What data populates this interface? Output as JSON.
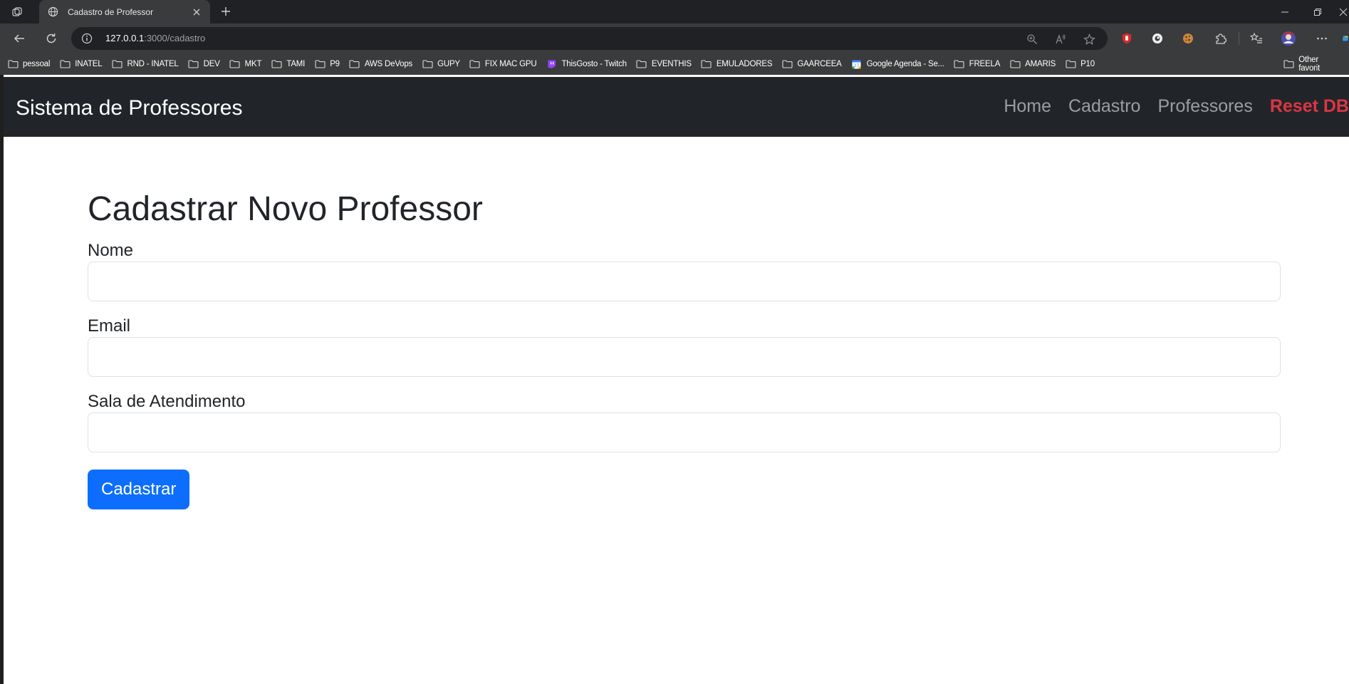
{
  "browser": {
    "tab_title": "Cadastro de Professor",
    "url_host": "127.0.0.1",
    "url_rest": ":3000/cadastro",
    "bookmarks": [
      {
        "label": "pessoal",
        "icon": "folder-icon"
      },
      {
        "label": "INATEL",
        "icon": "folder-icon"
      },
      {
        "label": "RND - INATEL",
        "icon": "folder-icon"
      },
      {
        "label": "DEV",
        "icon": "folder-icon"
      },
      {
        "label": "MKT",
        "icon": "folder-icon"
      },
      {
        "label": "TAMI",
        "icon": "folder-icon"
      },
      {
        "label": "P9",
        "icon": "folder-icon"
      },
      {
        "label": "AWS DeVops",
        "icon": "folder-icon"
      },
      {
        "label": "GUPY",
        "icon": "folder-icon"
      },
      {
        "label": "FIX MAC GPU",
        "icon": "folder-icon"
      },
      {
        "label": "ThisGosto - Twitch",
        "icon": "twitch-icon"
      },
      {
        "label": "EVENTHIS",
        "icon": "folder-icon"
      },
      {
        "label": "EMULADORES",
        "icon": "folder-icon"
      },
      {
        "label": "GAARCEEA",
        "icon": "folder-icon"
      },
      {
        "label": "Google Agenda - Se...",
        "icon": "calendar-icon"
      },
      {
        "label": "FREELA",
        "icon": "folder-icon"
      },
      {
        "label": "AMARIS",
        "icon": "folder-icon"
      },
      {
        "label": "P10",
        "icon": "folder-icon"
      }
    ],
    "other_favorites": "Other favorit"
  },
  "navbar": {
    "brand": "Sistema de Professores",
    "links": {
      "home": "Home",
      "cadastro": "Cadastro",
      "professores": "Professores",
      "reset": "Reset DB"
    }
  },
  "form": {
    "title": "Cadastrar Novo Professor",
    "fields": {
      "nome": {
        "label": "Nome",
        "value": ""
      },
      "email": {
        "label": "Email",
        "value": ""
      },
      "sala": {
        "label": "Sala de Atendimento",
        "value": ""
      }
    },
    "submit_label": "Cadastrar"
  },
  "colors": {
    "navbar_bg": "#212529",
    "primary": "#0d6efd",
    "danger": "#dc3545"
  }
}
